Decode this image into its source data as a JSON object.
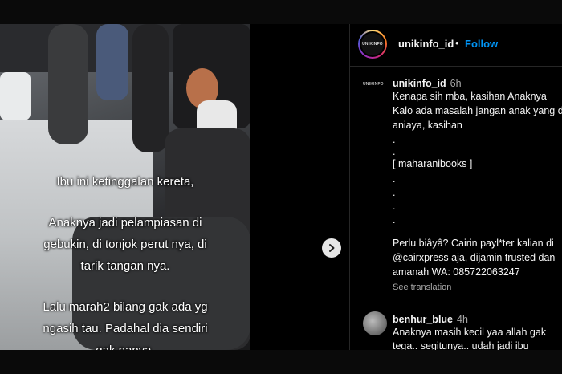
{
  "post": {
    "caption_lines": [
      "Ibu ini ketinggalan kereta,",
      "",
      "Anaknya jadi pelampiasan di",
      "gebukin, di tonjok perut nya, di",
      "tarik tangan nya.",
      "",
      "Lalu marah2 bilang gak ada yg",
      "ngasih tau. Padahal dia sendiri",
      "gak nanya."
    ],
    "next_icon": "chevron-right-icon"
  },
  "header": {
    "avatar_logo": "UNIKINFO",
    "username": "unikinfo_id",
    "separator": "•",
    "follow_label": "Follow"
  },
  "comments": [
    {
      "avatar_logo": "UNIKINFO",
      "username": "unikinfo_id",
      "time": "6h",
      "lines": [
        "Kenapa sih mba, kasihan Anaknya",
        "Kalo ada masalah jangan anak yang d",
        "aniaya, kasihan",
        ".",
        ".",
        "[ maharanibooks ]",
        ".",
        ".",
        ".",
        ".",
        "Perlu biâyâ? Cairin payl*ter kalian di",
        "@cairxpress aja, dijamin trusted dan",
        "amanah WA: 085722063247"
      ],
      "see_translation": "See translation"
    },
    {
      "username": "benhur_blue",
      "time": "4h",
      "lines": [
        "Anaknya masih kecil yaa allah gak",
        "tega.. segitunya.. udah jadi ibu"
      ]
    }
  ]
}
